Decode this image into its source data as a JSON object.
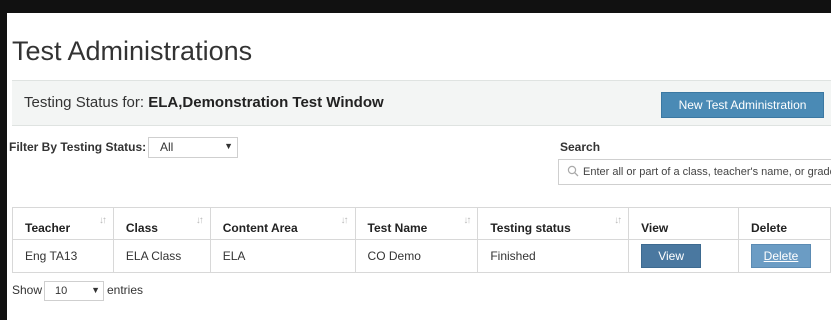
{
  "page": {
    "title": "Test Administrations"
  },
  "status_bar": {
    "prefix": "Testing Status for: ",
    "window_name": "ELA,Demonstration Test Window",
    "new_button": "New Test Administration"
  },
  "filter": {
    "label": "Filter By Testing Status:",
    "selected": "All"
  },
  "search": {
    "label": "Search",
    "placeholder": "Enter all or part of a class, teacher's name, or grade"
  },
  "table": {
    "columns": [
      "Teacher",
      "Class",
      "Content Area",
      "Test Name",
      "Testing status",
      "View",
      "Delete"
    ],
    "rows": [
      {
        "teacher": "Eng TA13",
        "class": "ELA Class",
        "content_area": "ELA",
        "test_name": "CO Demo",
        "testing_status": "Finished",
        "view_label": "View",
        "delete_label": "Delete"
      }
    ]
  },
  "pagination": {
    "show_label": "Show",
    "page_length": "10",
    "entries_label": "entries"
  },
  "colors": {
    "primary_button": "#4a8ab5",
    "view_button": "#4a78a0",
    "delete_button": "#6b9cc4",
    "status_bar_bg": "#f3f5f4"
  }
}
